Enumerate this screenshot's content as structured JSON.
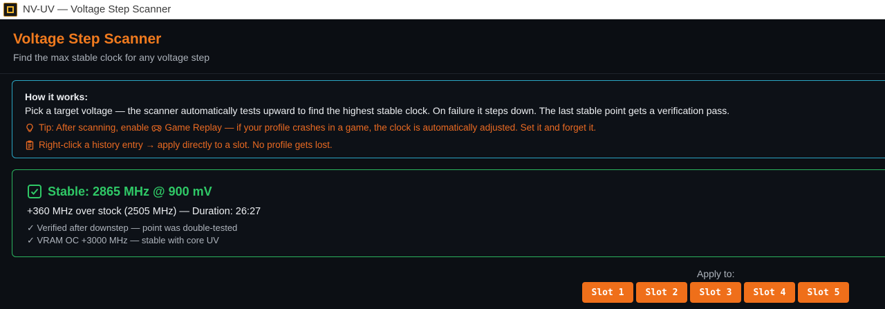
{
  "window": {
    "title": "NV-UV — Voltage Step Scanner",
    "icon": "gpu-chip-icon"
  },
  "header": {
    "title": "Voltage Step Scanner",
    "subtitle": "Find the max stable clock for any voltage step"
  },
  "info": {
    "heading": "How it works:",
    "body": "Pick a target voltage — the scanner automatically tests upward to find the highest stable clock. On failure it steps down. The last stable point gets a verification pass.",
    "tip_prefix": "Tip: After scanning, enable",
    "tip_feature": "Game Replay",
    "tip_suffix": "— if your profile crashes in a game, the clock is automatically adjusted. Set it and forget it.",
    "tip_icon": "lightbulb-icon",
    "feature_icon": "gamepad-icon",
    "history_hint": "Right-click a history entry → apply directly to a slot. No profile gets lost.",
    "history_icon": "clipboard-icon"
  },
  "result": {
    "icon": "checkbox-checked-icon",
    "title": "Stable: 2865 MHz @ 900 mV",
    "summary": "+360 MHz over stock (2505 MHz) — Duration: 26:27",
    "notes": [
      "✓ Verified after downstep — point was double-tested",
      "✓ VRAM OC +3000 MHz — stable with core UV"
    ]
  },
  "apply": {
    "label": "Apply to:",
    "slots": [
      "Slot 1",
      "Slot 2",
      "Slot 3",
      "Slot 4",
      "Slot 5"
    ]
  },
  "colors": {
    "accent": "#ef6f1a",
    "info_border": "#2aa6c4",
    "success": "#2fc866",
    "background": "#0c0f14"
  }
}
